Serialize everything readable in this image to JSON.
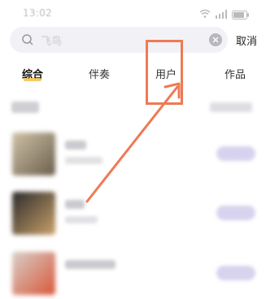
{
  "status_bar": {
    "time": "13:02",
    "battery": "77"
  },
  "search": {
    "query": "飞鸟",
    "cancel_label": "取消"
  },
  "tabs": [
    {
      "label": "综合",
      "active": true
    },
    {
      "label": "伴奏",
      "active": false
    },
    {
      "label": "用户",
      "active": false
    },
    {
      "label": "作品",
      "active": false
    }
  ],
  "colors": {
    "accent_underline": "#f3c34b",
    "annotation": "#ee7a55",
    "search_bg": "#f2f2f6"
  },
  "section": {
    "title": "伴奏"
  },
  "results": [
    {
      "title": "飞鸟"
    },
    {
      "title": "飞鸟"
    },
    {
      "title": "飞鸟 (Live)"
    }
  ]
}
